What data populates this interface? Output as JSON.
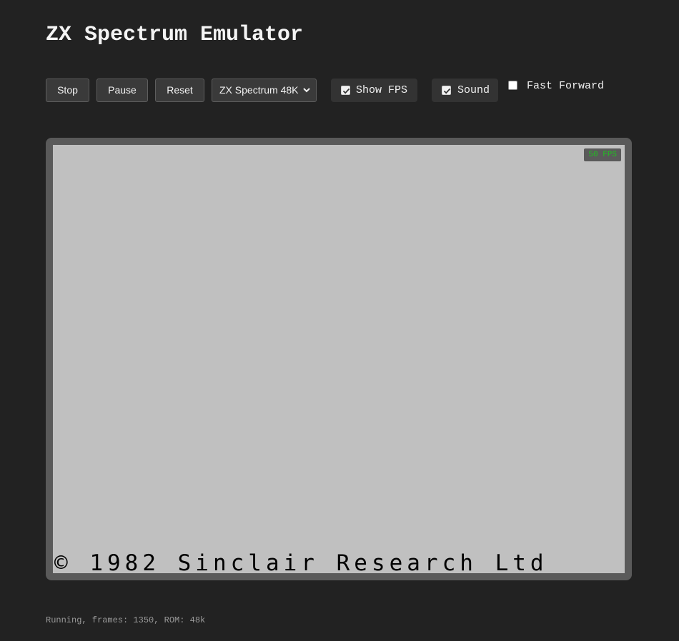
{
  "app": {
    "title": "ZX Spectrum Emulator"
  },
  "toolbar": {
    "stop_label": "Stop",
    "pause_label": "Pause",
    "reset_label": "Reset",
    "model_select": {
      "selected": "ZX Spectrum 48K"
    },
    "show_fps": {
      "label": "Show FPS",
      "checked": true
    },
    "sound": {
      "label": "Sound",
      "checked": true
    },
    "fast_forward": {
      "label": "Fast Forward",
      "checked": false
    }
  },
  "screen": {
    "fps_badge": "50 FPS",
    "fps_color": "#20c020",
    "background_color": "#c0c0c0",
    "copyright_text": "© 1982 Sinclair Research Ltd"
  },
  "status": {
    "text": "Running, frames: 1350, ROM: 48k"
  },
  "colors": {
    "page_background": "#222222",
    "frame": "#5a5a5a"
  }
}
